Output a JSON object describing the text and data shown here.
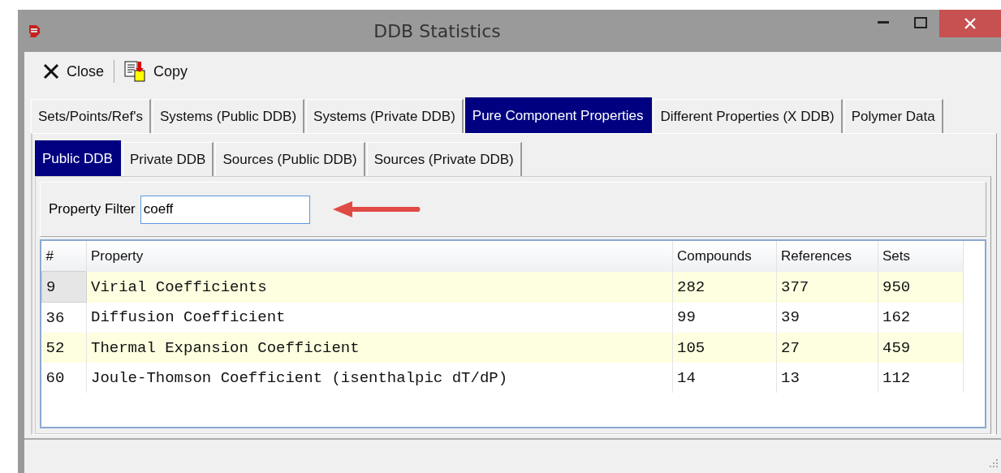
{
  "window": {
    "title": "DDB Statistics"
  },
  "toolbar": [
    {
      "kind": "close",
      "label": "Close"
    },
    {
      "kind": "copy",
      "label": "Copy"
    }
  ],
  "tabs": [
    {
      "label": "Sets/Points/Ref's",
      "selected": false
    },
    {
      "label": "Systems (Public DDB)",
      "selected": false
    },
    {
      "label": "Systems (Private DDB)",
      "selected": false
    },
    {
      "label": "Pure Component Properties",
      "selected": true
    },
    {
      "label": "Different Properties (X DDB)",
      "selected": false
    },
    {
      "label": "Polymer Data",
      "selected": false
    }
  ],
  "subtabs": [
    {
      "label": "Public DDB",
      "selected": true
    },
    {
      "label": "Private DDB",
      "selected": false
    },
    {
      "label": "Sources (Public DDB)",
      "selected": false
    },
    {
      "label": "Sources (Private DDB)",
      "selected": false
    }
  ],
  "filter": {
    "label": "Property Filter",
    "value": "coeff"
  },
  "table": {
    "columns": [
      "#",
      "Property",
      "Compounds",
      "References",
      "Sets"
    ],
    "rows": [
      {
        "cells": [
          "9",
          "Virial Coefficients",
          "282",
          "377",
          "950"
        ],
        "selected": true
      },
      {
        "cells": [
          "36",
          "Diffusion Coefficient",
          "99",
          "39",
          "162"
        ],
        "selected": false
      },
      {
        "cells": [
          "52",
          "Thermal Expansion Coefficient",
          "105",
          "27",
          "459"
        ],
        "selected": false
      },
      {
        "cells": [
          "60",
          "Joule-Thomson Coefficient (isenthalpic dT/dP)",
          "14",
          "13",
          "112"
        ],
        "selected": false
      }
    ]
  }
}
